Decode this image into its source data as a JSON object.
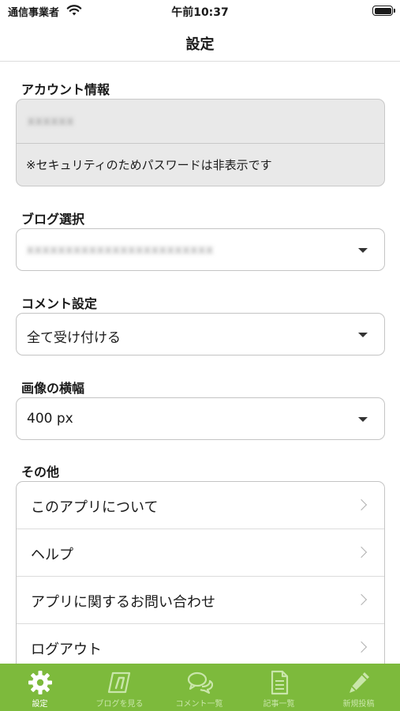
{
  "status_bar": {
    "carrier": "通信事業者",
    "time": "午前10:37",
    "battery_level": 1.0
  },
  "nav": {
    "title": "設定"
  },
  "account": {
    "section_title": "アカウント情報",
    "account_id_redacted": "xxxxxx",
    "password_note": "※セキュリティのためパスワードは非表示です"
  },
  "blog_select": {
    "section_title": "ブログ選択",
    "value_redacted": "xxxxxxxxxxxxxxxxxxxxxxxx"
  },
  "comment_setting": {
    "section_title": "コメント設定",
    "value": "全て受け付ける"
  },
  "image_width": {
    "section_title": "画像の横幅",
    "value": "400 px"
  },
  "other": {
    "section_title": "その他",
    "items": [
      {
        "label": "このアプリについて"
      },
      {
        "label": "ヘルプ"
      },
      {
        "label": "アプリに関するお問い合わせ"
      },
      {
        "label": "ログアウト"
      }
    ]
  },
  "tab_bar": {
    "tabs": [
      {
        "label": "設定",
        "icon": "gear-icon",
        "active": true
      },
      {
        "label": "ブログを見る",
        "icon": "blog-icon",
        "active": false
      },
      {
        "label": "コメント一覧",
        "icon": "comments-icon",
        "active": false
      },
      {
        "label": "記事一覧",
        "icon": "document-icon",
        "active": false
      },
      {
        "label": "新規投稿",
        "icon": "pencil-icon",
        "active": false
      }
    ]
  },
  "colors": {
    "tab_bar_background": "#7dba3c",
    "tab_active": "#ffffff",
    "tab_inactive": "#c9e6aa",
    "readonly_background": "#e9e9e9"
  }
}
